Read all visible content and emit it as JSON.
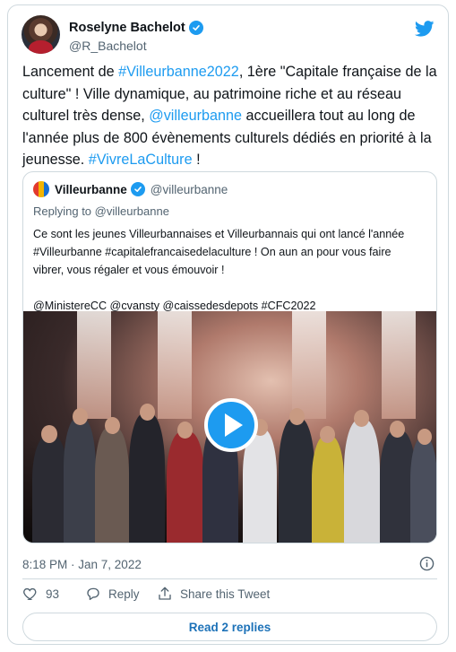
{
  "tweet": {
    "author_name": "Roselyne Bachelot",
    "author_handle": "@R_Bachelot",
    "text_segments": [
      {
        "text": "Lancement de ",
        "link": false
      },
      {
        "text": "#Villeurbanne2022",
        "link": true
      },
      {
        "text": ", 1ère \"Capitale française de la culture\" ! Ville dynamique, au patrimoine riche et au réseau culturel très dense, ",
        "link": false
      },
      {
        "text": "@villeurbanne",
        "link": true
      },
      {
        "text": " accueillera tout au long de l'année plus de 800 évènements culturels dédiés en priorité à la jeunesse. ",
        "link": false
      },
      {
        "text": "#VivreLaCulture",
        "link": true
      },
      {
        "text": " !",
        "link": false
      }
    ],
    "timestamp": "8:18 PM · Jan 7, 2022",
    "likes_count": "93",
    "reply_label": "Reply",
    "share_label": "Share this Tweet",
    "read_replies_label": "Read 2 replies"
  },
  "quoted": {
    "name": "Villeurbanne",
    "handle": "@villeurbanne",
    "replying_to": "Replying to @villeurbanne",
    "lines": [
      "Ce sont les jeunes Villeurbannaises et Villeurbannais qui ont lancé l'année",
      "#Villeurbanne #capitalefrancaisedelaculture ! On aun an pour vous faire",
      "vibrer, vous  régaler et vous émouvoir !",
      "",
      "@MinistereCC @cvansty @caissedesdepots #CFC2022"
    ]
  },
  "colors": {
    "accent": "#1d9bf0",
    "text": "#0f1419",
    "muted": "#536471",
    "border": "#cfd9de"
  },
  "icons": [
    "verified-badge-icon",
    "twitter-logo-icon",
    "play-icon",
    "info-icon",
    "heart-icon",
    "reply-icon",
    "share-icon"
  ]
}
